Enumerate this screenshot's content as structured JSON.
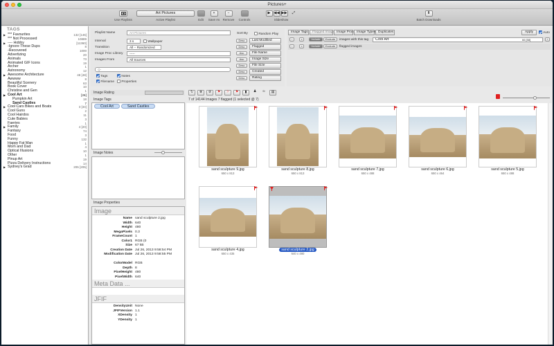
{
  "window": {
    "title": "Pictures+"
  },
  "toolbar": {
    "use_playlists": "Use Playlists",
    "active_playlist_value": "Art Pictures",
    "active_playlist_label": "Active Playlist",
    "edit": "Edit",
    "save_as": "Save As",
    "remove": "Remove",
    "controls": "Controls",
    "slideshow": "Slideshow",
    "batch_downloads": "Batch Downloads"
  },
  "sidebar": {
    "header": "TAGS",
    "tags": [
      {
        "name": "*** Favourites",
        "count": "132 [146]",
        "level": 0,
        "arrow": true
      },
      {
        "name": "*** Not Processed",
        "count": "10889",
        "level": 0
      },
      {
        "name": "---- Hobby",
        "count": "[11360]",
        "level": 0,
        "arrow": true
      },
      {
        "name": "-Ignore These Dups",
        "count": "8",
        "level": 0
      },
      {
        "name": "-Recovered",
        "count": "1000",
        "level": 0
      },
      {
        "name": "Advertizing",
        "count": "20",
        "level": 0
      },
      {
        "name": "Animals",
        "count": "73",
        "level": 0
      },
      {
        "name": "Animated GIF Icons",
        "count": "19",
        "level": 0
      },
      {
        "name": "Archer",
        "count": "1",
        "level": 0
      },
      {
        "name": "Astronomy",
        "count": "12",
        "level": 0
      },
      {
        "name": "Awesome Architecture",
        "count": "48 [48]",
        "level": 0,
        "arrow": true
      },
      {
        "name": "Awwww",
        "count": "8",
        "level": 0
      },
      {
        "name": "Beautiful Scenery",
        "count": "63",
        "level": 0
      },
      {
        "name": "Book Cover",
        "count": "10",
        "level": 0
      },
      {
        "name": "Christine and Gen",
        "count": "1",
        "level": 0
      },
      {
        "name": "Cool Art",
        "count": "[26]",
        "level": 0,
        "arrow": true,
        "bold": true
      },
      {
        "name": "Pumpkin Art",
        "count": "18",
        "level": 1
      },
      {
        "name": "Sand Castles",
        "count": "7",
        "level": 1,
        "bold": true
      },
      {
        "name": "Cool Cars Bikes and Boats",
        "count": "3 [34]",
        "level": 0,
        "arrow": true
      },
      {
        "name": "Cool Guns",
        "count": "2",
        "level": 0
      },
      {
        "name": "Cool Hairdos",
        "count": "11",
        "level": 0
      },
      {
        "name": "Cute Babies",
        "count": "3",
        "level": 0
      },
      {
        "name": "Faeries",
        "count": "1",
        "level": 0
      },
      {
        "name": "Family",
        "count": "4 [20]",
        "level": 0,
        "arrow": true
      },
      {
        "name": "Fantasy",
        "count": "74",
        "level": 0
      },
      {
        "name": "Food",
        "count": "3",
        "level": 0
      },
      {
        "name": "Funny",
        "count": "132",
        "level": 0
      },
      {
        "name": "Happy Fat Man",
        "count": "1",
        "level": 0
      },
      {
        "name": "Mom and Dad",
        "count": "4",
        "level": 0
      },
      {
        "name": "Optical Illusions",
        "count": "10",
        "level": 0
      },
      {
        "name": "Other",
        "count": "1",
        "level": 0
      },
      {
        "name": "Pinup Art",
        "count": "19",
        "level": 0
      },
      {
        "name": "Pizza Delivery Instructions",
        "count": "14",
        "level": 0
      },
      {
        "name": "Sydney's Grad",
        "count": "205 [205]",
        "level": 0,
        "arrow": true
      }
    ]
  },
  "controls": {
    "playlist_name_label": "Playlist Name",
    "playlist_name_placeholder": "Art Pictures",
    "interval_label": "Interval",
    "interval_value": "3 s",
    "wallpaper_label": "Wallpaper",
    "transition_label": "Transition",
    "transition_value": "All -- Randomized",
    "image_proc_label": "Image Proc Library",
    "image_proc_value": "-----",
    "images_from_label": "Images From",
    "images_from_value": "All Sources",
    "search_placeholder": "Q-",
    "tags_label": "Tags",
    "notes_label": "Notes",
    "filename_label": "Filename",
    "properties_label": "Properties",
    "sort_by": "Sort By",
    "random_play": "Random Play",
    "sort_options": [
      {
        "dir": "Desc",
        "name": "Last Modified"
      },
      {
        "dir": "Desc",
        "name": "Flagged"
      },
      {
        "dir": "Asc",
        "name": "File Name"
      },
      {
        "dir": "Asc",
        "name": "Image Size"
      },
      {
        "dir": "Desc",
        "name": "File Size"
      },
      {
        "dir": "Desc",
        "name": "Created"
      },
      {
        "dir": "Desc",
        "name": "Rating"
      }
    ]
  },
  "filters": {
    "tabs": [
      "Image Tags",
      "Flagged Images",
      "Image Procs",
      "Image Types",
      "Duplicates"
    ],
    "apply": "Apply",
    "auto": "Auto",
    "rows": [
      {
        "include": "Include",
        "exclude": "Exclude",
        "text": "images with this tag",
        "value": "Cool Art",
        "extra": "66 [58]"
      },
      {
        "include": "Include",
        "exclude": "Exclude",
        "text": "flagged images",
        "value": ""
      }
    ]
  },
  "left_panels": {
    "rating_label": "Image Rating",
    "tags_label": "Image Tags",
    "tags": [
      "Cool Art",
      "Sand Castles"
    ],
    "notes_label": "Image Notes",
    "props_label": "Image Properties",
    "sections": [
      {
        "title": "Image",
        "props": [
          {
            "k": "Name",
            "v": "sand sculpture 2.jpg"
          },
          {
            "k": "Width",
            "v": "640"
          },
          {
            "k": "Height",
            "v": "480"
          },
          {
            "k": "MegaPixels",
            "v": "0.3"
          },
          {
            "k": "FrameCount",
            "v": "1"
          },
          {
            "k": "Color1",
            "v": "RGB (0"
          },
          {
            "k": "Size",
            "v": "67 kB"
          },
          {
            "k": "Creation Date",
            "v": "Jul 26, 2013 9:58:54 PM"
          },
          {
            "k": "Modification Date",
            "v": "Jul 26, 2013 9:58:55 PM"
          },
          {
            "k": "",
            "v": ""
          },
          {
            "k": "ColorModel",
            "v": "RGB"
          },
          {
            "k": "Depth",
            "v": "8"
          },
          {
            "k": "PixelHeight",
            "v": "480"
          },
          {
            "k": "PixelWidth",
            "v": "640"
          }
        ]
      },
      {
        "title": "Meta Data ...",
        "props": []
      },
      {
        "title": "JFIF",
        "props": [
          {
            "k": "DensityUnit",
            "v": "None"
          },
          {
            "k": "JFIFVersion",
            "v": "1.1"
          },
          {
            "k": "XDensity",
            "v": "1"
          },
          {
            "k": "YDensity",
            "v": "1"
          }
        ]
      }
    ]
  },
  "grid": {
    "status": "7 of 14144 Images  7 flagged (1 selected @ 7)",
    "images": [
      {
        "name": "sand sculpture 9.jpg",
        "dim": "650 x 813",
        "sel": false
      },
      {
        "name": "sand sculpture 8.jpg",
        "dim": "650 x 813",
        "sel": false
      },
      {
        "name": "sand sculpture 7.jpg",
        "dim": "650 x 488",
        "sel": false
      },
      {
        "name": "sand sculpture 6.jpg",
        "dim": "650 x 464",
        "sel": false
      },
      {
        "name": "sand sculpture 5.jpg",
        "dim": "650 x 488",
        "sel": false
      },
      {
        "name": "sand sculpture 4.jpg",
        "dim": "650 x 435",
        "sel": false
      },
      {
        "name": "sand sculpture 2.jpg",
        "dim": "640 x 480",
        "sel": true
      }
    ]
  },
  "colors": {
    "accent": "#2457c2",
    "flag": "#e02020",
    "titlebar": "#d8d8d8"
  }
}
